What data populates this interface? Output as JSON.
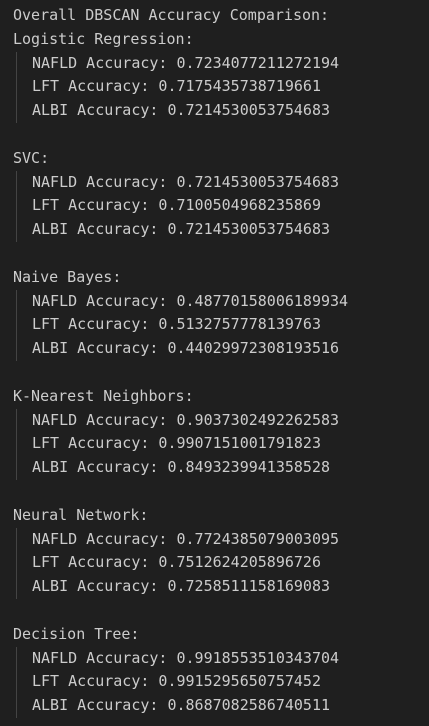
{
  "title": "Overall DBSCAN Accuracy Comparison:",
  "models": [
    {
      "name": "Logistic Regression:",
      "metrics": [
        "NAFLD Accuracy: 0.7234077211272194",
        "LFT Accuracy: 0.7175435738719661",
        "ALBI Accuracy: 0.7214530053754683"
      ]
    },
    {
      "name": "SVC:",
      "metrics": [
        "NAFLD Accuracy: 0.7214530053754683",
        "LFT Accuracy: 0.7100504968235869",
        "ALBI Accuracy: 0.7214530053754683"
      ]
    },
    {
      "name": "Naive Bayes:",
      "metrics": [
        "NAFLD Accuracy: 0.48770158006189934",
        "LFT Accuracy: 0.5132757778139763",
        "ALBI Accuracy: 0.44029972308193516"
      ]
    },
    {
      "name": "K-Nearest Neighbors:",
      "metrics": [
        "NAFLD Accuracy: 0.9037302492262583",
        "LFT Accuracy: 0.9907151001791823",
        "ALBI Accuracy: 0.8493239941358528"
      ]
    },
    {
      "name": "Neural Network:",
      "metrics": [
        "NAFLD Accuracy: 0.7724385079003095",
        "LFT Accuracy: 0.7512624205896726",
        "ALBI Accuracy: 0.7258511158169083"
      ]
    },
    {
      "name": "Decision Tree:",
      "metrics": [
        "NAFLD Accuracy: 0.9918553510343704",
        "LFT Accuracy: 0.9915295650757452",
        "ALBI Accuracy: 0.8687082586740511"
      ]
    }
  ]
}
